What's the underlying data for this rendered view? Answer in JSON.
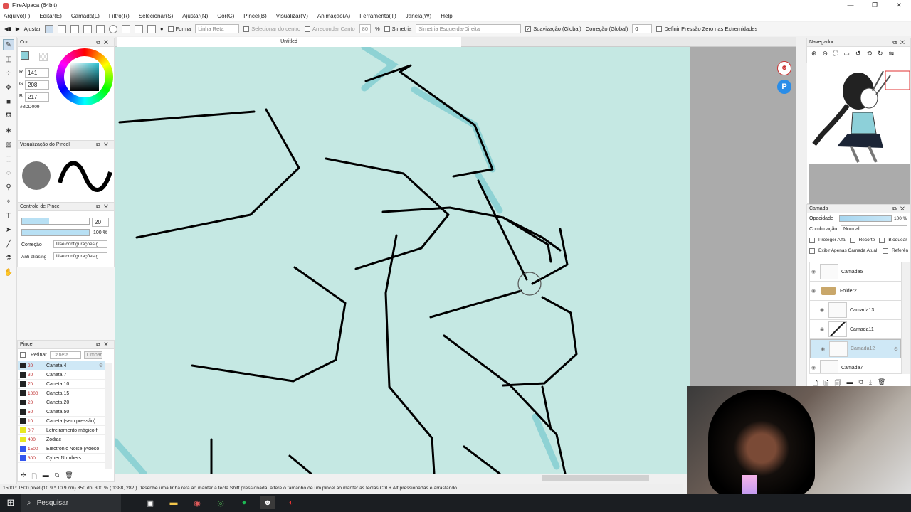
{
  "app": {
    "title": "FireAlpaca (64bit)",
    "minimize": "—",
    "maximize": "❐",
    "close": "✕"
  },
  "menu": [
    "Arquivo(F)",
    "Editar(E)",
    "Camada(L)",
    "Filtro(R)",
    "Selecionar(S)",
    "Ajustar(N)",
    "Cor(C)",
    "Pincel(B)",
    "Visualizar(V)",
    "Animação(A)",
    "Ferramenta(T)",
    "Janela(W)",
    "Help"
  ],
  "toolbar": {
    "ajustar": "Ajustar",
    "forma": "Forma",
    "linha_reta": "Linha Reta",
    "selecionar_centro": "Selecionar do centro",
    "arredondar_canto": "Arredondar Canto",
    "canto_value": "80",
    "canto_unit": "%",
    "simetria": "Simetria",
    "simetria_value": "Simetria Esquerda-Direita",
    "suavizacao": "Suavização (Global)",
    "correcao_global": "Correção (Global)",
    "correcao_value": "0",
    "pressao": "Definir Pressão Zero nas Extremidades"
  },
  "color_panel": {
    "title": "Cor",
    "r_label": "R",
    "r": "141",
    "g_label": "G",
    "g": "208",
    "b_label": "B",
    "b": "217",
    "hex": "#8DD009",
    "primary_color": "#8dd0d9"
  },
  "brush_preview": {
    "title": "Visualização do Pincel"
  },
  "brush_control": {
    "title": "Controle de Pincel",
    "size": "20",
    "opacity": "100 %",
    "correcao": "Correção",
    "correcao_value": "Use configurações g",
    "anti": "Anti-aliasing",
    "anti_value": "Use configurações g"
  },
  "brush_panel": {
    "title": "Pincel",
    "refinar": "Refinar",
    "caneta": "Caneta",
    "limpar": "Limpar",
    "items": [
      {
        "size": "20",
        "name": "Caneta 4",
        "color": "#222222"
      },
      {
        "size": "30",
        "name": "Caneta 7",
        "color": "#222222"
      },
      {
        "size": "70",
        "name": "Caneta 10",
        "color": "#222222"
      },
      {
        "size": "1000",
        "name": "Caneta 15",
        "color": "#222222"
      },
      {
        "size": "20",
        "name": "Caneta 20",
        "color": "#222222"
      },
      {
        "size": "50",
        "name": "Caneta 50",
        "color": "#222222"
      },
      {
        "size": "10",
        "name": "Caneta (sem pressão)",
        "color": "#222222"
      },
      {
        "size": "0.7",
        "name": "Letreiramento mágico fi",
        "color": "#e8e820"
      },
      {
        "size": "400",
        "name": "Zodiac",
        "color": "#e8e820"
      },
      {
        "size": "1500",
        "name": "Electronic Noise [Adeso",
        "color": "#3355ee"
      },
      {
        "size": "300",
        "name": "Cyber Numbers",
        "color": "#3355ee"
      }
    ]
  },
  "canvas": {
    "tab_title": "Untitled"
  },
  "navigator": {
    "title": "Navegador"
  },
  "layer_panel": {
    "title": "Camada",
    "opacidade": "Opacidade",
    "opacity_value": "100 %",
    "combinacao": "Combinação",
    "combinacao_value": "Normal",
    "proteger": "Proteger Alfa",
    "recorte": "Recorte",
    "bloquear": "Bloquear",
    "exibir": "Exibir Apenas Camada Atual",
    "referencia": "Referên",
    "layers": [
      {
        "name": "Camada5",
        "indent": false,
        "selected": false,
        "folder": false
      },
      {
        "name": "Folder2",
        "indent": false,
        "selected": false,
        "folder": true
      },
      {
        "name": "Camada13",
        "indent": true,
        "selected": false,
        "folder": false
      },
      {
        "name": "Camada11",
        "indent": true,
        "selected": false,
        "folder": false
      },
      {
        "name": "Camada12",
        "indent": true,
        "selected": true,
        "folder": false
      },
      {
        "name": "Camada7",
        "indent": false,
        "selected": false,
        "folder": false
      }
    ]
  },
  "status": "1500 * 1500 pixel  (10.9 * 10.9 cm)  350 dpi  300 %  ( 1388, 282 )  Desenhe uma linha reta ao manter a tecla Shift pressionada, altere o tamanho de um pincel ao manter as teclas Ctrl + Alt pressionadas e arrastando",
  "taskbar": {
    "search": "Pesquisar"
  }
}
